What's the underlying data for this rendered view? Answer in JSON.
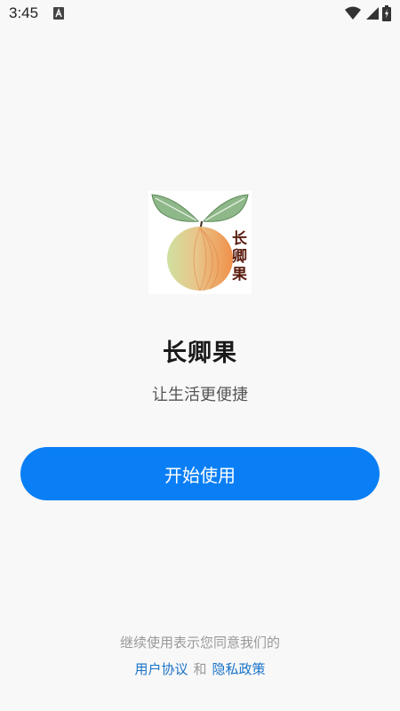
{
  "status_bar": {
    "time": "3:45",
    "icons": [
      "a-notification-icon",
      "wifi-icon",
      "signal-icon",
      "battery-charging-icon"
    ]
  },
  "logo": {
    "icon": "apple-fruit-logo",
    "text": "长卿果"
  },
  "app": {
    "name": "长卿果",
    "tagline": "让生活更便捷"
  },
  "actions": {
    "start_label": "开始使用"
  },
  "consent": {
    "text": "继续使用表示您同意我们的",
    "user_agreement": "用户协议",
    "and": "和",
    "privacy_policy": "隐私政策"
  },
  "colors": {
    "primary": "#0a7ff5",
    "link": "#1a73c8",
    "background": "#f8f8f8"
  }
}
